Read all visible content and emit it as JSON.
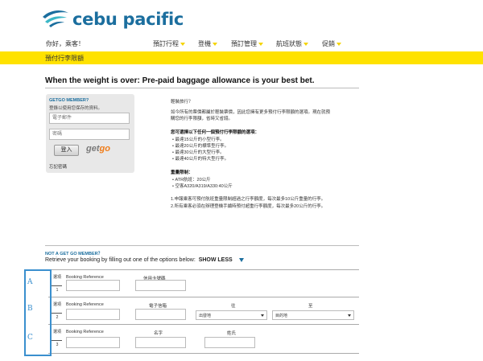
{
  "brand": {
    "name": "cebu pacific",
    "color": "#1b6e9e",
    "accent": "#ffe200"
  },
  "nav": {
    "greeting": "你好，乘客！",
    "items": [
      "預訂行程",
      "登機",
      "預訂管理",
      "航班狀態",
      "促銷"
    ]
  },
  "page_title": "預付行李限額",
  "headline": "When the weight is over: Pre-paid baggage allowance is your best bet.",
  "login": {
    "title": "GETGO MEMBER?",
    "subtitle": "登錄以使用您保存的資料。",
    "email_placeholder": "電子郵件",
    "password_placeholder": "密碼",
    "button": "登入",
    "getgo_logo_get": "get",
    "getgo_logo_go": "go",
    "forgot": "忘記密碼"
  },
  "info": {
    "lines": [
      "輕裝旅行？",
      "如今所有的票價都屬於輕裝票價，因此您擁有更多預付行李限額的選項。現在就預",
      "購您的行李限額，省時又省錢。"
    ],
    "options_title": "您可選擇以下任何一個預付行李限額的選項：",
    "options": [
      "最達15公斤的小型行李。",
      "最達20公斤的標準型行李。",
      "最達30公斤的大型行李。",
      "最達40公斤的特大型行李。"
    ],
    "limits_title": "重量限制：",
    "limits": [
      "ATR航班：20公斤",
      "空客A320/A319/A330:40公斤"
    ],
    "notes": [
      "1.申報乘客可預付航班重量限制超過之行李額度，每次最多10公斤重量的行李。",
      "2.所有乘客必須在辦理登機手續時預付超重行李額度，每次最多20公斤的行李。"
    ]
  },
  "retrieve": {
    "not_member": "NOT A GET GO MEMBER？",
    "text": "Retrieve your booking by filling out one of the options below:",
    "toggle": "SHOW LESS"
  },
  "options": [
    {
      "label": "選項",
      "num": "1",
      "cols": [
        "Booking Reference",
        "信用卡號碼"
      ]
    },
    {
      "label": "選項",
      "num": "2",
      "cols": [
        "Booking Reference",
        "電子信箱",
        "往",
        "至"
      ],
      "selects": [
        "出發地",
        "目的地"
      ]
    },
    {
      "label": "選項",
      "num": "3",
      "cols": [
        "Booking Reference",
        "名字",
        "姓氏"
      ]
    }
  ],
  "annotation": {
    "letters": [
      "A",
      "B",
      "C"
    ],
    "color": "#3a8fce"
  }
}
